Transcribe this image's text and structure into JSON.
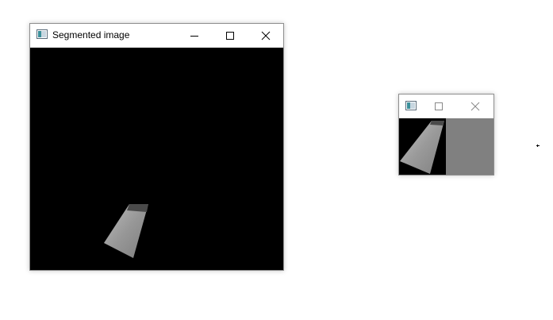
{
  "main_window": {
    "title": "Segmented image",
    "app_icon": "window-app-icon",
    "controls": [
      "minimize-icon",
      "maximize-icon",
      "close-icon"
    ],
    "content": "segmented-object-on-black"
  },
  "small_window": {
    "title": "",
    "app_icon": "window-app-icon",
    "controls": [
      "maximize-icon",
      "close-icon"
    ],
    "content": "segmented-object-and-gray-panel"
  },
  "colors": {
    "client_background": "#000000",
    "gray_panel": "#808080",
    "object_fill": "#9a9a9a",
    "titlebar": "#ffffff"
  }
}
